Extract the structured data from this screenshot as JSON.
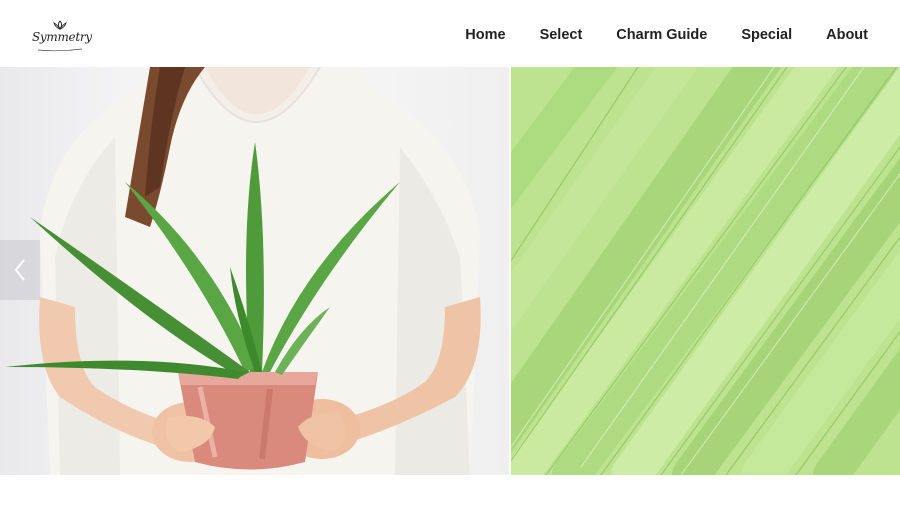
{
  "brand": {
    "logo_text": "Symmetry"
  },
  "nav": {
    "items": [
      "Home",
      "Select",
      "Charm Guide",
      "Special",
      "About"
    ]
  },
  "slider": {
    "prev_icon": "chevron-left-icon"
  },
  "colors": {
    "nav_text": "#222222",
    "leaf_green": "#b8de8c",
    "pot_copper": "#d98a7c"
  }
}
